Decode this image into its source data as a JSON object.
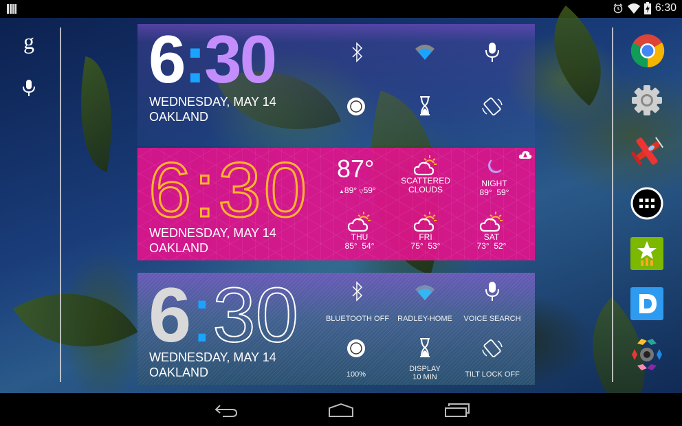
{
  "status_bar": {
    "time": "6:30",
    "icons": [
      "notification-icon",
      "alarm-icon",
      "wifi-icon",
      "battery-charging-icon"
    ]
  },
  "left_dock": {
    "search_icon": "google-search-icon",
    "voice_icon": "voice-search-icon"
  },
  "right_dock": {
    "apps": [
      {
        "name": "Chrome",
        "icon": "chrome-icon"
      },
      {
        "name": "Settings",
        "icon": "settings-gear-icon"
      },
      {
        "name": "Airplane game",
        "icon": "red-airplane-icon"
      },
      {
        "name": "All apps",
        "icon": "app-drawer-icon"
      },
      {
        "name": "Ratings",
        "icon": "star-chart-icon"
      },
      {
        "name": "D app",
        "icon": "d-letter-icon"
      },
      {
        "name": "Color hub",
        "icon": "gem-ring-icon"
      }
    ]
  },
  "widget1": {
    "hour": "6",
    "colon": ":",
    "minutes": "30",
    "date": "WEDNESDAY, MAY 14",
    "location": "OAKLAND",
    "toggles": [
      {
        "icon": "bluetooth-icon"
      },
      {
        "icon": "wifi-icon"
      },
      {
        "icon": "microphone-icon"
      },
      {
        "icon": "brightness-icon"
      },
      {
        "icon": "hourglass-icon"
      },
      {
        "icon": "rotation-icon"
      }
    ],
    "colors": {
      "hour": "#ffffff",
      "colon": "#1aa3ff",
      "minutes": "#c38dfc"
    }
  },
  "widget2": {
    "time": "6:30",
    "date": "WEDNESDAY, MAY 14",
    "location": "OAKLAND",
    "current_temp": "87°",
    "high": "89°",
    "low": "59°",
    "condition_line1": "SCATTERED",
    "condition_line2": "CLOUDS",
    "night": {
      "label": "NIGHT",
      "temps": "89°  59°"
    },
    "forecast": [
      {
        "day": "THU",
        "temps": "85°  54°"
      },
      {
        "day": "FRI",
        "temps": "75°  53°"
      },
      {
        "day": "SAT",
        "temps": "73°  52°"
      }
    ],
    "alert_icon": "weather-alert-icon",
    "colors": {
      "background": "#e0148c",
      "clock": "#ffb52a"
    }
  },
  "widget3": {
    "hour": "6",
    "colon": ":",
    "minutes": "30",
    "date": "WEDNESDAY, MAY 14",
    "location": "OAKLAND",
    "toggles": [
      {
        "icon": "bluetooth-icon",
        "label": "BLUETOOTH OFF"
      },
      {
        "icon": "wifi-icon",
        "label": "RADLEY-HOME"
      },
      {
        "icon": "microphone-icon",
        "label": "VOICE SEARCH"
      },
      {
        "icon": "brightness-icon",
        "label": "100%"
      },
      {
        "icon": "hourglass-icon",
        "label_line1": "DISPLAY",
        "label_line2": "10 MIN"
      },
      {
        "icon": "rotation-icon",
        "label": "TILT LOCK OFF"
      }
    ]
  },
  "nav_bar": {
    "back": "back-icon",
    "home": "home-icon",
    "recents": "recents-icon"
  }
}
